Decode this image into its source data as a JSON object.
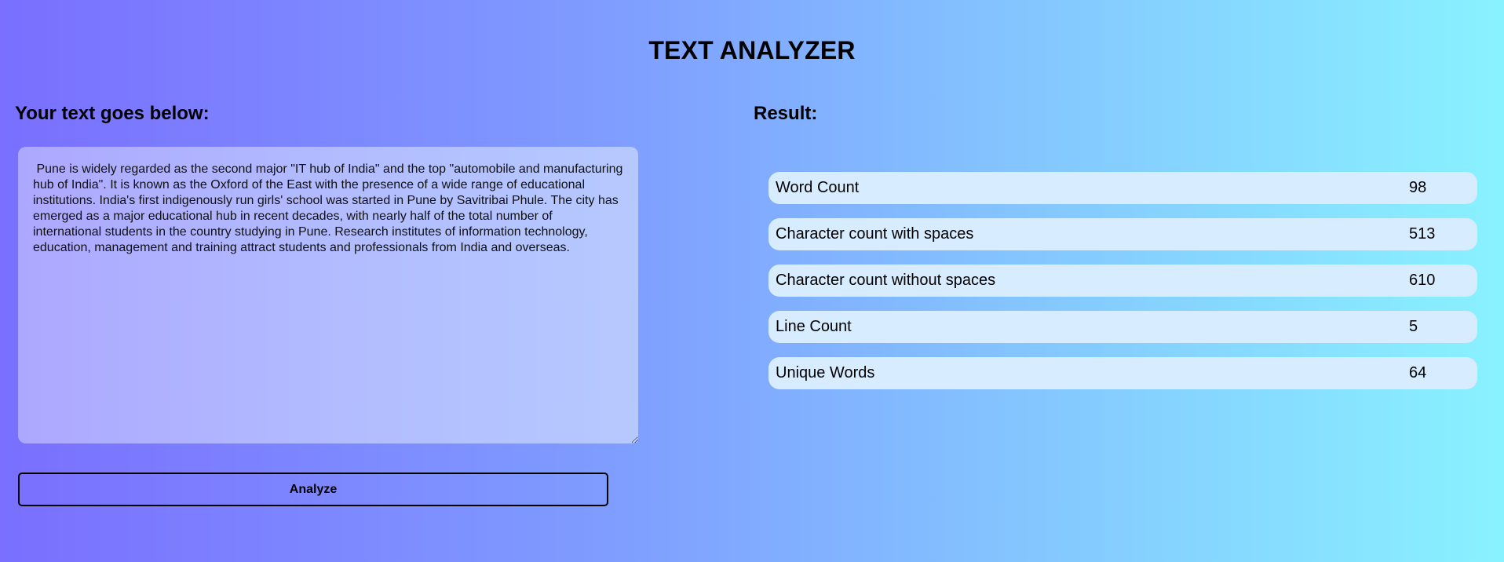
{
  "app": {
    "title": "TEXT ANALYZER"
  },
  "input_panel": {
    "heading": "Your text goes below:",
    "text_value": " Pune is widely regarded as the second major \"IT hub of India\" and the top \"automobile and manufacturing hub of India\". It is known as the Oxford of the East with the presence of a wide range of educational institutions. India's first indigenously run girls' school was started in Pune by Savitribai Phule. The city has emerged as a major educational hub in recent decades, with nearly half of the total number of international students in the country studying in Pune. Research institutes of information technology, education, management and training attract students and professionals from India and overseas.",
    "analyze_label": "Analyze"
  },
  "result_panel": {
    "heading": "Result:",
    "rows": [
      {
        "label": "Word Count",
        "value": "98"
      },
      {
        "label": "Character count with spaces",
        "value": "513"
      },
      {
        "label": "Character count without spaces",
        "value": "610"
      },
      {
        "label": "Line Count",
        "value": "5"
      },
      {
        "label": "Unique Words",
        "value": "64"
      }
    ]
  },
  "colors": {
    "gradient_start": "#7a6fff",
    "gradient_end": "#89f2ff",
    "result_row_bg": "#d7ecff"
  }
}
